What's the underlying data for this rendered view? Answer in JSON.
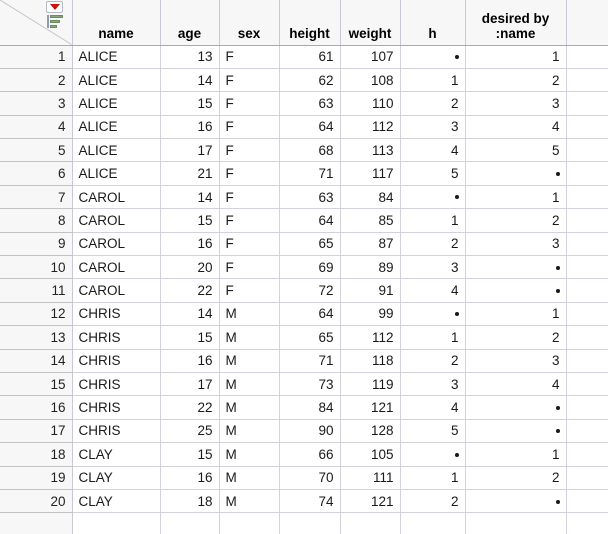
{
  "table": {
    "corner": {
      "menu_icon": "red-dropdown-triangle-icon",
      "sort_icon": "green-sort-bars-icon"
    },
    "columns": [
      {
        "key": "rownum",
        "label": "",
        "align": "right",
        "cls": "c-rownum"
      },
      {
        "key": "name",
        "label": "name",
        "align": "left",
        "cls": "c-name"
      },
      {
        "key": "age",
        "label": "age",
        "align": "right",
        "cls": "c-age"
      },
      {
        "key": "sex",
        "label": "sex",
        "align": "left",
        "cls": "c-sex"
      },
      {
        "key": "height",
        "label": "height",
        "align": "right",
        "cls": "c-height"
      },
      {
        "key": "weight",
        "label": "weight",
        "align": "right",
        "cls": "c-weight"
      },
      {
        "key": "h",
        "label": "h",
        "align": "right",
        "cls": "c-h"
      },
      {
        "key": "desired",
        "label": "desired by\n:name",
        "align": "right",
        "cls": "c-desired"
      },
      {
        "key": "blank",
        "label": "",
        "align": "left",
        "cls": "c-blank"
      }
    ],
    "missing_marker": "•",
    "rows": [
      {
        "rownum": "1",
        "name": "ALICE",
        "age": "13",
        "sex": "F",
        "height": "61",
        "weight": "107",
        "h": "•",
        "desired": "1"
      },
      {
        "rownum": "2",
        "name": "ALICE",
        "age": "14",
        "sex": "F",
        "height": "62",
        "weight": "108",
        "h": "1",
        "desired": "2"
      },
      {
        "rownum": "3",
        "name": "ALICE",
        "age": "15",
        "sex": "F",
        "height": "63",
        "weight": "110",
        "h": "2",
        "desired": "3"
      },
      {
        "rownum": "4",
        "name": "ALICE",
        "age": "16",
        "sex": "F",
        "height": "64",
        "weight": "112",
        "h": "3",
        "desired": "4"
      },
      {
        "rownum": "5",
        "name": "ALICE",
        "age": "17",
        "sex": "F",
        "height": "68",
        "weight": "113",
        "h": "4",
        "desired": "5"
      },
      {
        "rownum": "6",
        "name": "ALICE",
        "age": "21",
        "sex": "F",
        "height": "71",
        "weight": "117",
        "h": "5",
        "desired": "•"
      },
      {
        "rownum": "7",
        "name": "CAROL",
        "age": "14",
        "sex": "F",
        "height": "63",
        "weight": "84",
        "h": "•",
        "desired": "1"
      },
      {
        "rownum": "8",
        "name": "CAROL",
        "age": "15",
        "sex": "F",
        "height": "64",
        "weight": "85",
        "h": "1",
        "desired": "2"
      },
      {
        "rownum": "9",
        "name": "CAROL",
        "age": "16",
        "sex": "F",
        "height": "65",
        "weight": "87",
        "h": "2",
        "desired": "3"
      },
      {
        "rownum": "10",
        "name": "CAROL",
        "age": "20",
        "sex": "F",
        "height": "69",
        "weight": "89",
        "h": "3",
        "desired": "•"
      },
      {
        "rownum": "11",
        "name": "CAROL",
        "age": "22",
        "sex": "F",
        "height": "72",
        "weight": "91",
        "h": "4",
        "desired": "•"
      },
      {
        "rownum": "12",
        "name": "CHRIS",
        "age": "14",
        "sex": "M",
        "height": "64",
        "weight": "99",
        "h": "•",
        "desired": "1"
      },
      {
        "rownum": "13",
        "name": "CHRIS",
        "age": "15",
        "sex": "M",
        "height": "65",
        "weight": "112",
        "h": "1",
        "desired": "2"
      },
      {
        "rownum": "14",
        "name": "CHRIS",
        "age": "16",
        "sex": "M",
        "height": "71",
        "weight": "118",
        "h": "2",
        "desired": "3"
      },
      {
        "rownum": "15",
        "name": "CHRIS",
        "age": "17",
        "sex": "M",
        "height": "73",
        "weight": "119",
        "h": "3",
        "desired": "4"
      },
      {
        "rownum": "16",
        "name": "CHRIS",
        "age": "22",
        "sex": "M",
        "height": "84",
        "weight": "121",
        "h": "4",
        "desired": "•"
      },
      {
        "rownum": "17",
        "name": "CHRIS",
        "age": "25",
        "sex": "M",
        "height": "90",
        "weight": "128",
        "h": "5",
        "desired": "•"
      },
      {
        "rownum": "18",
        "name": "CLAY",
        "age": "15",
        "sex": "M",
        "height": "66",
        "weight": "105",
        "h": "•",
        "desired": "1"
      },
      {
        "rownum": "19",
        "name": "CLAY",
        "age": "16",
        "sex": "M",
        "height": "70",
        "weight": "111",
        "h": "1",
        "desired": "2"
      },
      {
        "rownum": "20",
        "name": "CLAY",
        "age": "18",
        "sex": "M",
        "height": "74",
        "weight": "121",
        "h": "2",
        "desired": "•"
      }
    ]
  },
  "colors": {
    "header_bg": "#f7f7f7",
    "gridline": "#d2d2dd",
    "menu_triangle": "#cc1111",
    "sort_bars": "#8aa57e",
    "text": "#1a1a1a"
  }
}
